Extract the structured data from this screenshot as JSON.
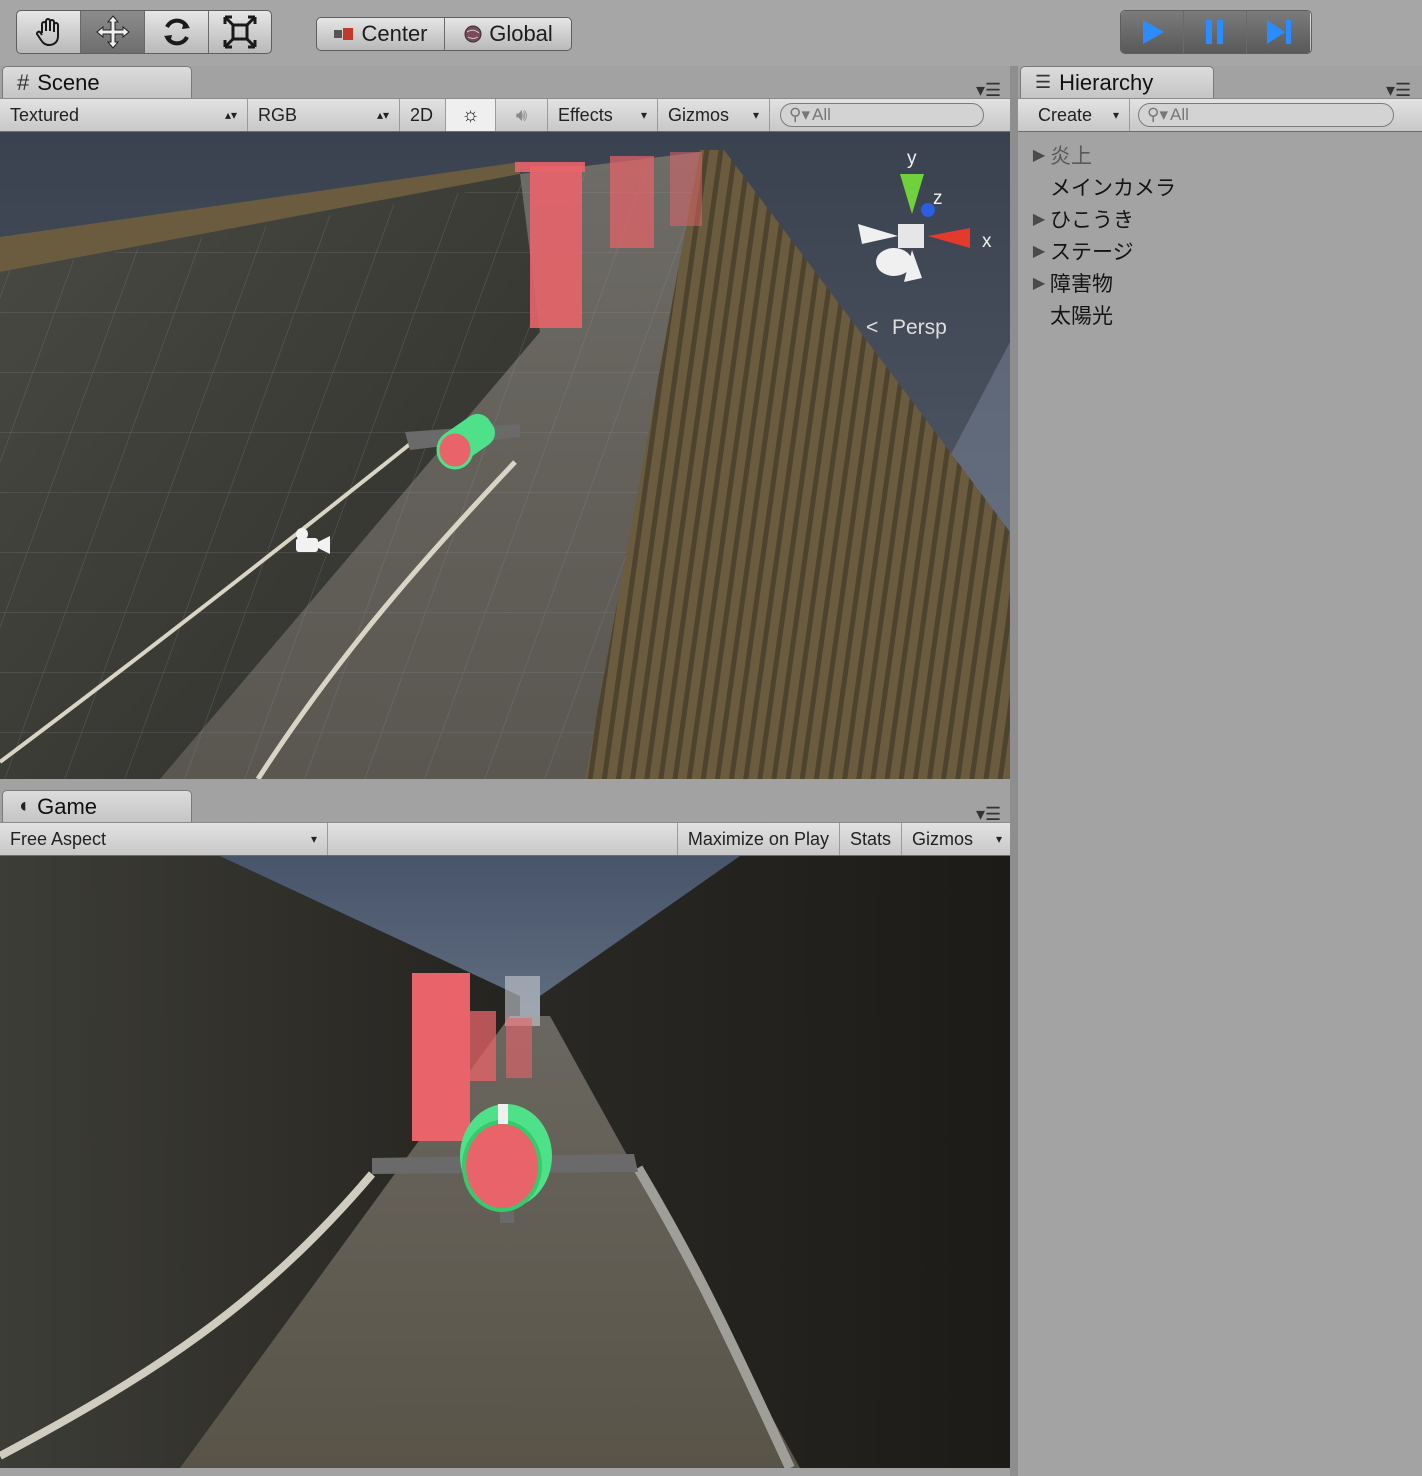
{
  "toolbar": {
    "tools": [
      "hand-icon",
      "move-icon",
      "rotate-icon",
      "scale-icon"
    ],
    "pivot_center": "Center",
    "pivot_global": "Global",
    "play_controls": [
      "play-icon",
      "pause-icon",
      "step-icon"
    ]
  },
  "scene": {
    "tab_label": "Scene",
    "draw_mode": "Textured",
    "render_mode": "RGB",
    "btn_2d": "2D",
    "effects": "Effects",
    "gizmos": "Gizmos",
    "search_placeholder": "All",
    "persp_label": "Persp",
    "axis_x": "x",
    "axis_y": "y",
    "axis_z": "z"
  },
  "game": {
    "tab_label": "Game",
    "aspect": "Free Aspect",
    "maximize": "Maximize on Play",
    "stats": "Stats",
    "gizmos": "Gizmos"
  },
  "hierarchy": {
    "tab_label": "Hierarchy",
    "create": "Create",
    "search_placeholder": "All",
    "items": [
      {
        "label": "炎上",
        "expandable": true,
        "dimmed": true
      },
      {
        "label": "メインカメラ",
        "expandable": false,
        "dimmed": false
      },
      {
        "label": "ひこうき",
        "expandable": true,
        "dimmed": false
      },
      {
        "label": "ステージ",
        "expandable": true,
        "dimmed": false
      },
      {
        "label": "障害物",
        "expandable": true,
        "dimmed": false
      },
      {
        "label": "太陽光",
        "expandable": false,
        "dimmed": false
      }
    ]
  },
  "colors": {
    "play_blue": "#2a8cff",
    "obstacle_red": "#e8646a",
    "plane_green": "#4fe08a"
  }
}
